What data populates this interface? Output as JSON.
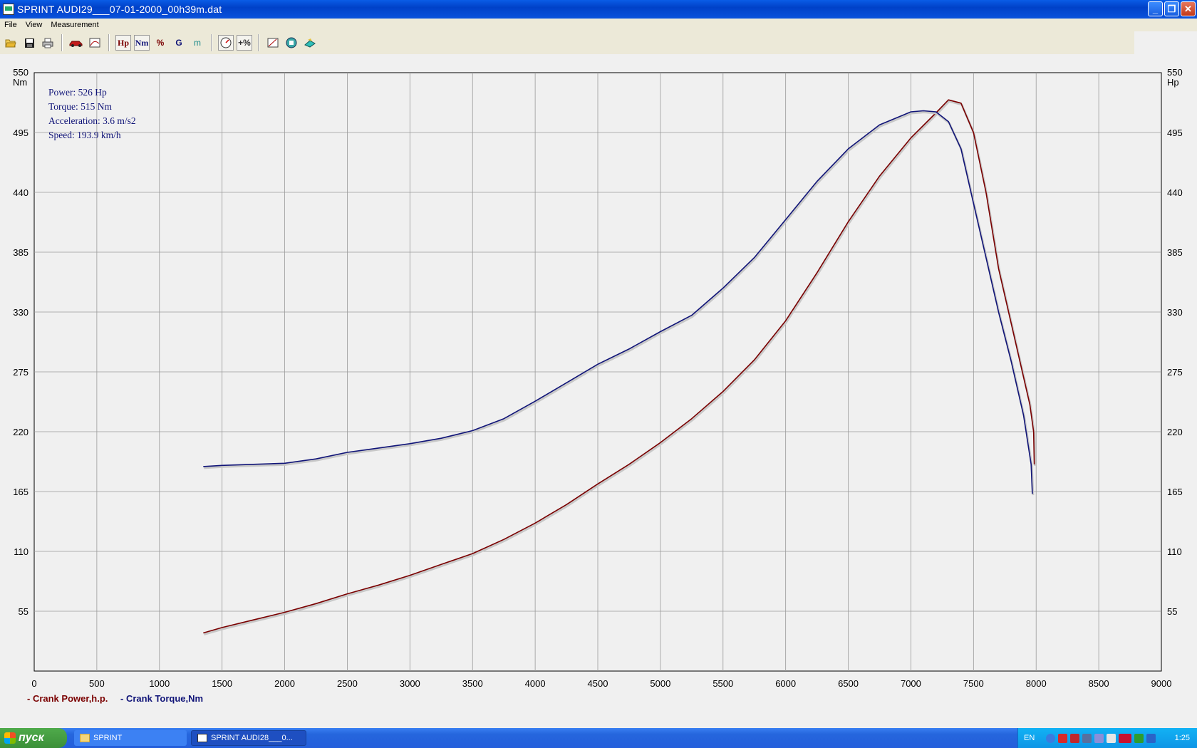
{
  "window": {
    "title": "SPRINT  AUDI29___07-01-2000_00h39m.dat",
    "minimize_icon": "minimize-icon",
    "maximize_icon": "restore-icon",
    "close_icon": "close-icon"
  },
  "menu": [
    "File",
    "View",
    "Measurement"
  ],
  "toolbar": {
    "buttons": [
      {
        "name": "open-icon"
      },
      {
        "name": "save-icon"
      },
      {
        "name": "print-icon"
      },
      {
        "name": "car-icon"
      },
      {
        "name": "graph-settings-icon"
      },
      {
        "label": "Hp",
        "color": "#7a0000"
      },
      {
        "label": "Nm",
        "color": "#101478"
      },
      {
        "label": "%",
        "color": "#7a0000"
      },
      {
        "label": "G",
        "color": "#101478"
      },
      {
        "label": "m",
        "color": "#1a8a8a"
      },
      {
        "name": "gauge-icon"
      },
      {
        "label": "+%",
        "color": "#000000"
      },
      {
        "name": "curve-icon"
      },
      {
        "name": "chip-icon"
      },
      {
        "name": "export-icon"
      }
    ]
  },
  "readout": {
    "power": "Power: 526 Hp",
    "torque": "Torque: 515 Nm",
    "acceleration": "Acceleration: 3.6 m/s2",
    "speed": "Speed: 193.9 km/h"
  },
  "chart_data": {
    "type": "line",
    "title": "",
    "xlabel": "",
    "ylabel_left": "Nm",
    "ylabel_right": "Hp",
    "xlim": [
      0,
      9000
    ],
    "ylim": [
      0,
      550
    ],
    "x_ticks": [
      0,
      500,
      1000,
      1500,
      2000,
      2500,
      3000,
      3500,
      4000,
      4500,
      5000,
      5500,
      6000,
      6500,
      7000,
      7500,
      8000,
      8500,
      9000
    ],
    "y_ticks": [
      55,
      110,
      165,
      220,
      275,
      330,
      385,
      440,
      495,
      550
    ],
    "grid": true,
    "legend_position": "bottom-left",
    "series": [
      {
        "name": "Crank Power,h.p.",
        "color": "#7a0000",
        "x": [
          1350,
          1500,
          1750,
          2000,
          2250,
          2500,
          2750,
          3000,
          3250,
          3500,
          3750,
          4000,
          4250,
          4500,
          4750,
          5000,
          5250,
          5500,
          5750,
          6000,
          6250,
          6500,
          6750,
          7000,
          7200,
          7300,
          7400,
          7500,
          7600,
          7700,
          7800,
          7900,
          7950,
          7980,
          7985
        ],
        "values": [
          35,
          40,
          47,
          54,
          62,
          71,
          79,
          88,
          98,
          108,
          121,
          136,
          153,
          172,
          190,
          210,
          232,
          257,
          286,
          322,
          366,
          413,
          455,
          490,
          513,
          525,
          522,
          495,
          440,
          370,
          320,
          270,
          245,
          220,
          190
        ]
      },
      {
        "name": "Crank Torque,Nm",
        "color": "#101478",
        "x": [
          1350,
          1500,
          1750,
          2000,
          2250,
          2500,
          2750,
          3000,
          3250,
          3500,
          3750,
          4000,
          4250,
          4500,
          4750,
          5000,
          5250,
          5500,
          5750,
          6000,
          6250,
          6500,
          6750,
          7000,
          7100,
          7200,
          7300,
          7400,
          7500,
          7600,
          7700,
          7800,
          7900,
          7960,
          7970
        ],
        "values": [
          188,
          189,
          190,
          191,
          195,
          201,
          205,
          209,
          214,
          221,
          232,
          248,
          265,
          282,
          296,
          312,
          327,
          352,
          380,
          415,
          450,
          480,
          502,
          514,
          515,
          514,
          505,
          480,
          430,
          380,
          330,
          285,
          235,
          190,
          163
        ]
      }
    ]
  },
  "legend": [
    {
      "label": "- Crank Power,h.p.",
      "color": "#7a0000"
    },
    {
      "label": "- Crank Torque,Nm",
      "color": "#101478"
    }
  ],
  "taskbar": {
    "start_label": "пуск",
    "tasks": [
      "SPRINT",
      "SPRINT  AUDI28___0..."
    ],
    "language": "EN",
    "clock": "1:25"
  }
}
